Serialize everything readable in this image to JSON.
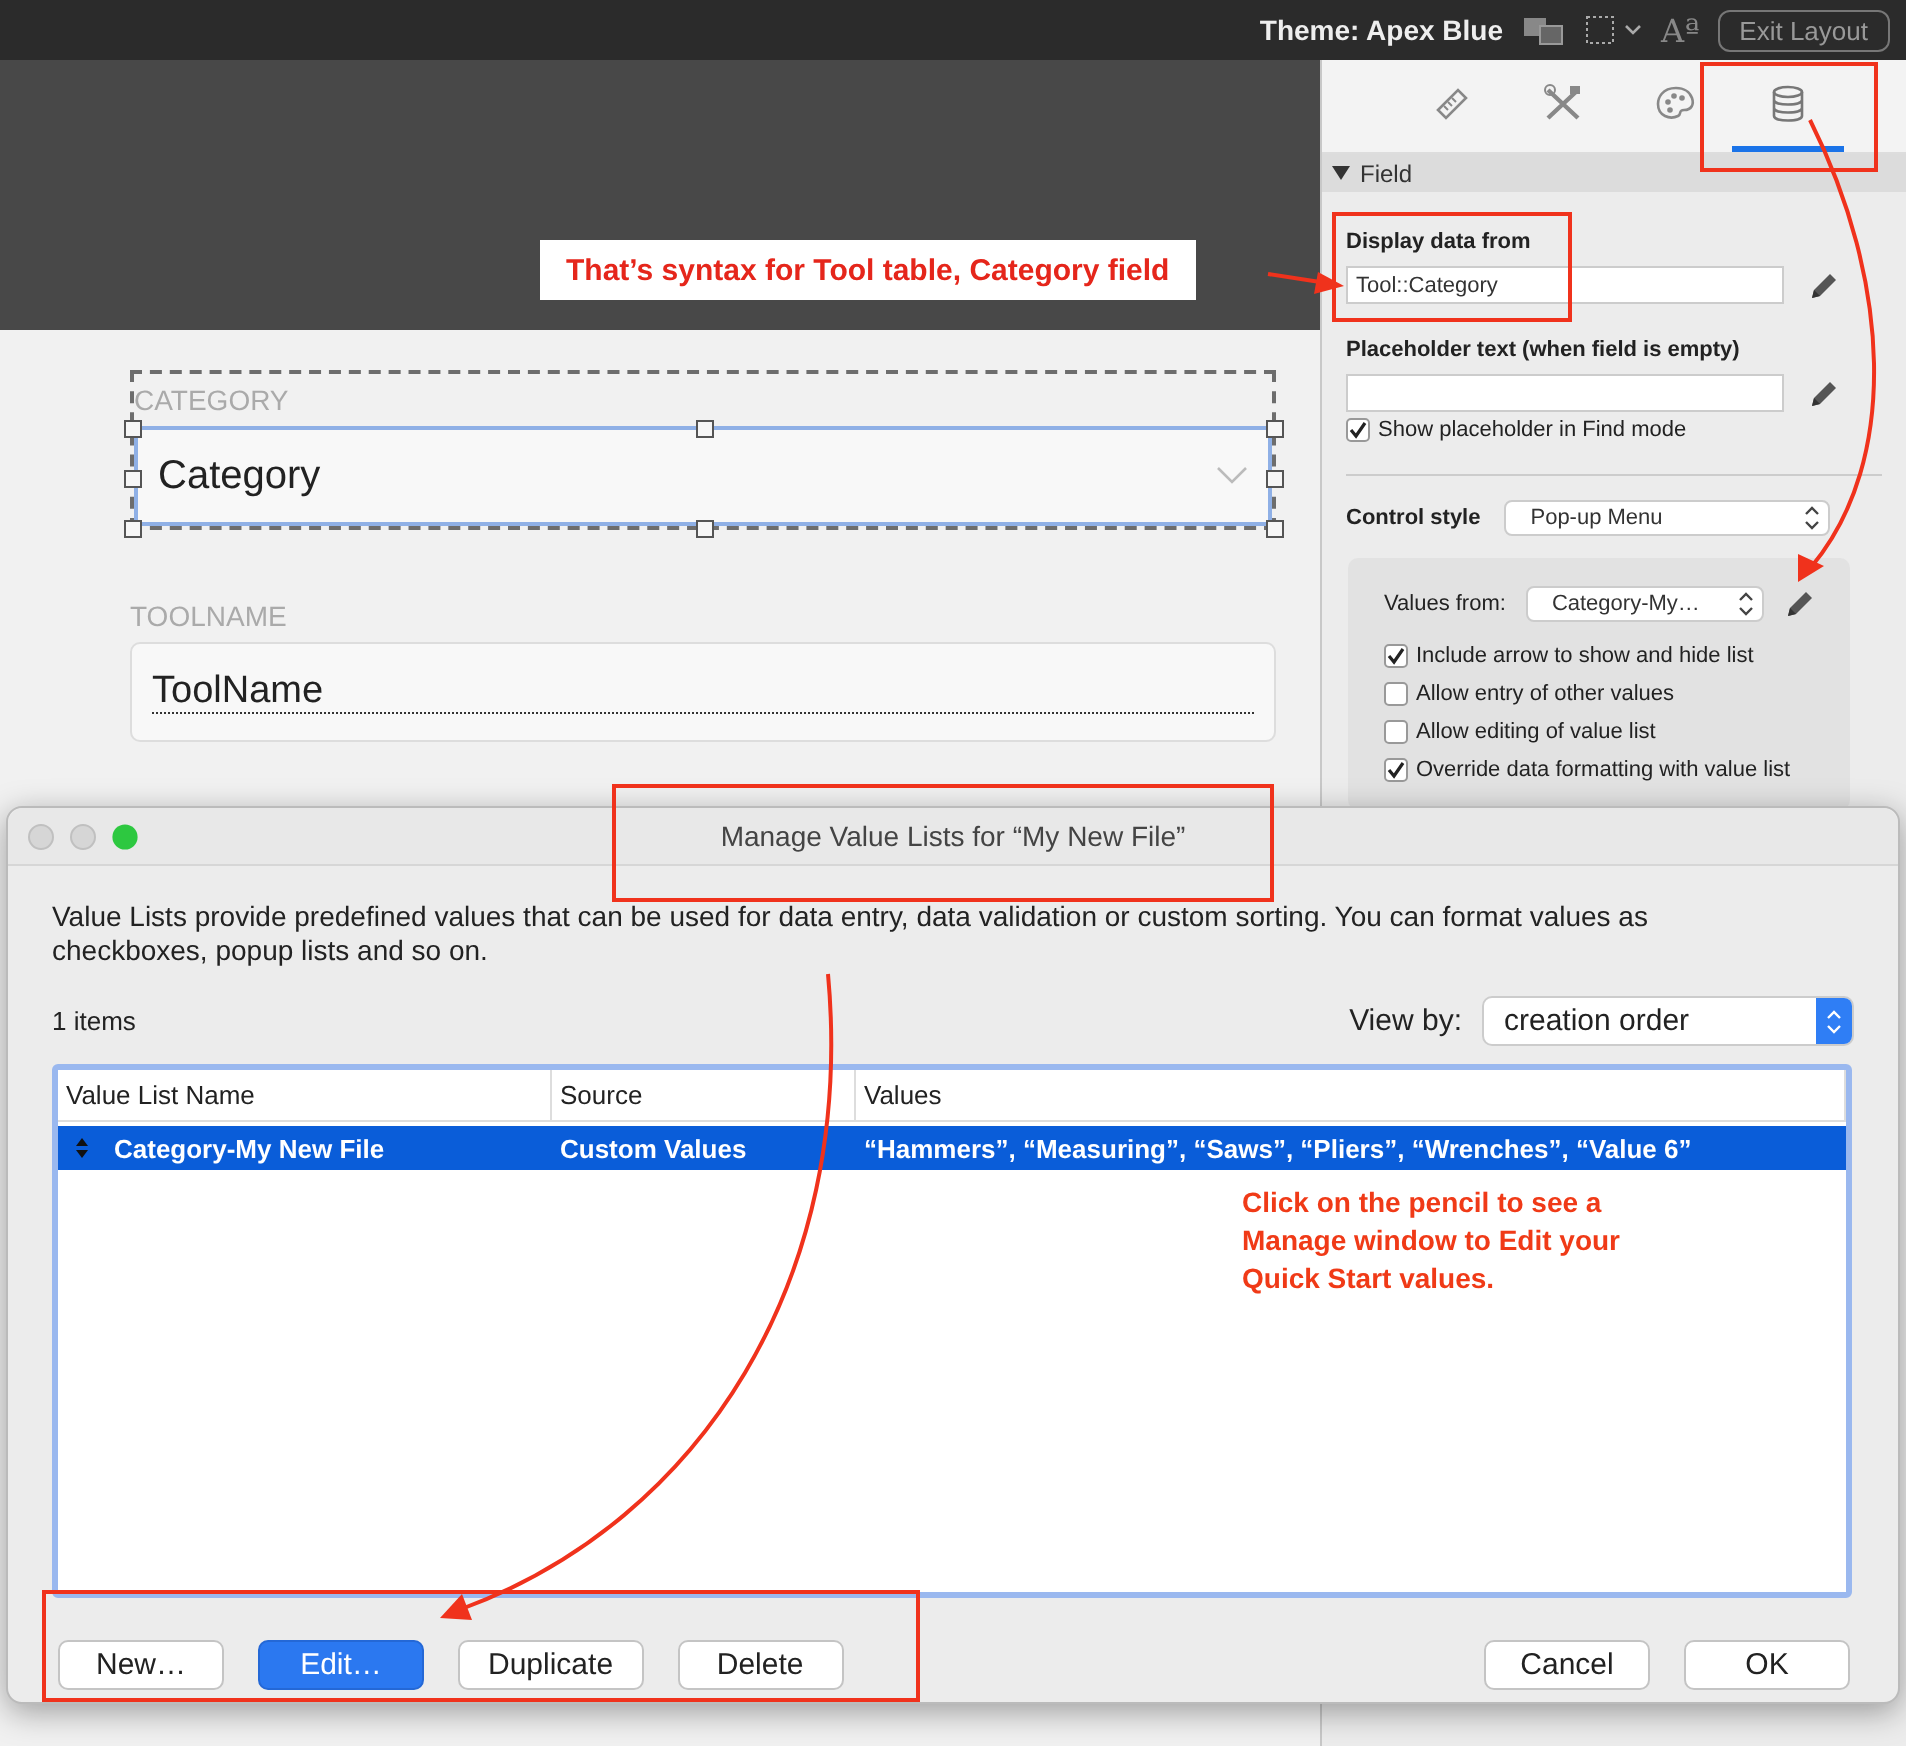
{
  "toolbar": {
    "theme_label": "Theme: Apex Blue",
    "text_format_glyph": "Aª",
    "exit_button": "Exit Layout"
  },
  "layout": {
    "fields": [
      {
        "label": "CATEGORY",
        "value": "Category",
        "kind": "popup",
        "selected": true
      },
      {
        "label": "TOOLNAME",
        "value": "ToolName",
        "kind": "text",
        "selected": false
      }
    ]
  },
  "inspector": {
    "tabs": [
      {
        "kind": "position",
        "selected": false
      },
      {
        "kind": "styles",
        "selected": false
      },
      {
        "kind": "appearance",
        "selected": false
      },
      {
        "kind": "data",
        "selected": true
      }
    ],
    "section": {
      "title": "Field",
      "expanded": true
    },
    "display_data_from": {
      "label": "Display data from",
      "value": "Tool::Category"
    },
    "placeholder_text": {
      "label": "Placeholder text (when field is empty)"
    },
    "show_placeholder": {
      "label": "Show placeholder in Find mode",
      "checked": true
    },
    "control_style": {
      "label": "Control style",
      "value": "Pop-up Menu"
    },
    "values_from": {
      "label": "Values from:",
      "value": "Category-My…"
    },
    "options": [
      {
        "label": "Include arrow to show and hide list",
        "checked": true
      },
      {
        "label": "Allow entry of other values",
        "checked": false
      },
      {
        "label": "Allow editing of value list",
        "checked": false
      },
      {
        "label": "Override data formatting with value list",
        "checked": true
      }
    ]
  },
  "dialog": {
    "title": "Manage Value Lists for “My New File”",
    "description": "Value Lists provide predefined values that can be used for data entry, data validation or custom sorting. You can format values as checkboxes, popup lists and so on.",
    "count": "1 items",
    "view_by": {
      "label": "View by:",
      "value": "creation order"
    },
    "table": {
      "columns": [
        "Value List Name",
        "Source",
        "Values"
      ],
      "rows": [
        {
          "cells": [
            "Category-My New File",
            "Custom Values",
            "“Hammers”, “Measuring”, “Saws”, “Pliers”, “Wrenches”, “Value 6”"
          ],
          "selected": true
        }
      ]
    },
    "buttons": [
      {
        "label": "New…",
        "default": false
      },
      {
        "label": "Edit…",
        "default": true
      },
      {
        "label": "Duplicate",
        "default": false
      },
      {
        "label": "Delete",
        "default": false
      }
    ],
    "dismiss_buttons": [
      {
        "label": "Cancel",
        "default": false
      },
      {
        "label": "OK",
        "default": false
      }
    ]
  },
  "annotations": [
    {
      "kind": "callout",
      "text": "That’s syntax for Tool table, Category field"
    },
    {
      "kind": "note",
      "text": "Click on the pencil to see a Manage window to Edit your Quick Start values."
    }
  ]
}
